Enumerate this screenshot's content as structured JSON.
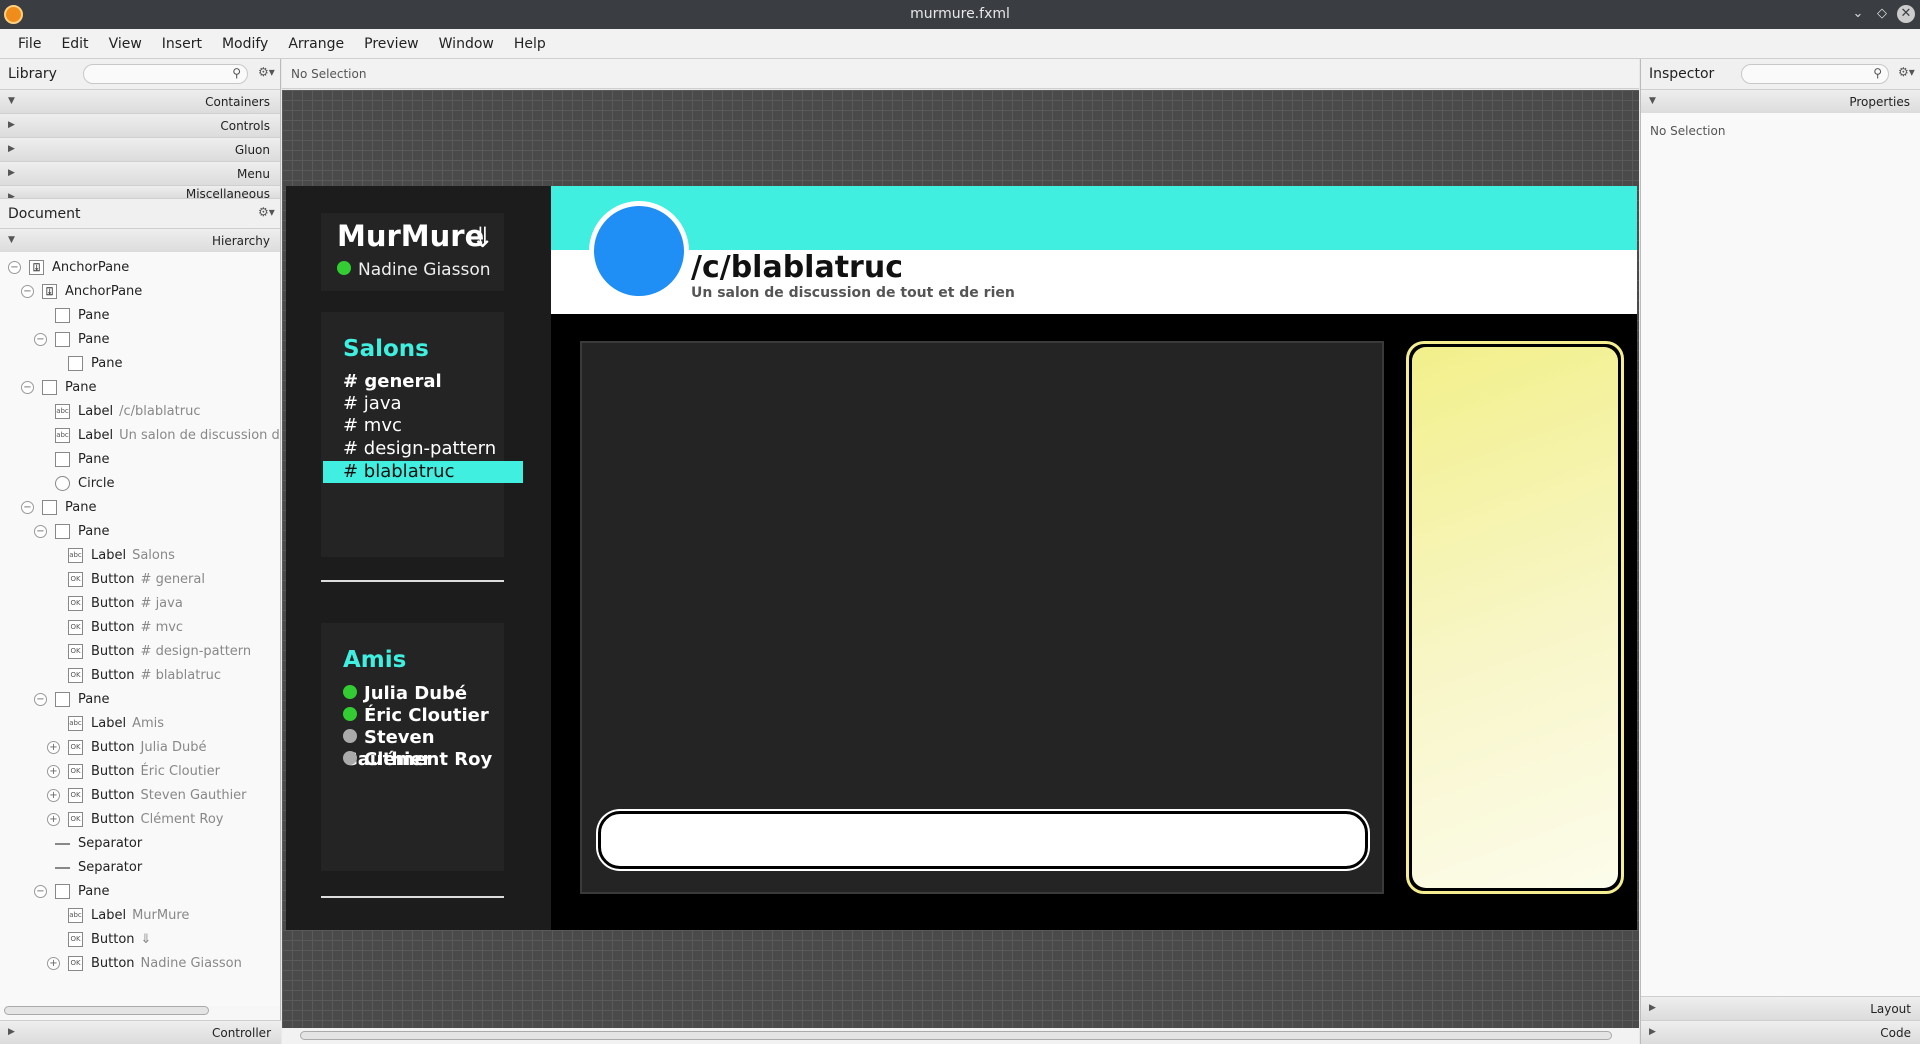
{
  "window": {
    "title": "murmure.fxml"
  },
  "menu": [
    "File",
    "Edit",
    "View",
    "Insert",
    "Modify",
    "Arrange",
    "Preview",
    "Window",
    "Help"
  ],
  "library": {
    "title": "Library",
    "sections": [
      "Containers",
      "Controls",
      "Gluon",
      "Menu",
      "Miscellaneous"
    ]
  },
  "document": {
    "title": "Document",
    "hierarchy_label": "Hierarchy",
    "nodes": [
      {
        "type": "AnchorPane",
        "value": "",
        "depth": 0,
        "toggle": "minus",
        "icon": "anchor"
      },
      {
        "type": "AnchorPane",
        "value": "",
        "depth": 1,
        "toggle": "minus",
        "icon": "anchor"
      },
      {
        "type": "Pane",
        "value": "",
        "depth": 2,
        "toggle": "",
        "icon": "box"
      },
      {
        "type": "Pane",
        "value": "",
        "depth": 2,
        "toggle": "minus",
        "icon": "box"
      },
      {
        "type": "Pane",
        "value": "",
        "depth": 3,
        "toggle": "",
        "icon": "box"
      },
      {
        "type": "Pane",
        "value": "",
        "depth": 1,
        "toggle": "minus",
        "icon": "box"
      },
      {
        "type": "Label",
        "value": "/c/blablatruc",
        "depth": 2,
        "toggle": "",
        "icon": "label"
      },
      {
        "type": "Label",
        "value": "Un salon de discussion de",
        "depth": 2,
        "toggle": "",
        "icon": "label"
      },
      {
        "type": "Pane",
        "value": "",
        "depth": 2,
        "toggle": "",
        "icon": "box"
      },
      {
        "type": "Circle",
        "value": "",
        "depth": 2,
        "toggle": "",
        "icon": "circle"
      },
      {
        "type": "Pane",
        "value": "",
        "depth": 1,
        "toggle": "minus",
        "icon": "box"
      },
      {
        "type": "Pane",
        "value": "",
        "depth": 2,
        "toggle": "minus",
        "icon": "box"
      },
      {
        "type": "Label",
        "value": "Salons",
        "depth": 3,
        "toggle": "",
        "icon": "label"
      },
      {
        "type": "Button",
        "value": "# general",
        "depth": 3,
        "toggle": "",
        "icon": "button"
      },
      {
        "type": "Button",
        "value": "# java",
        "depth": 3,
        "toggle": "",
        "icon": "button"
      },
      {
        "type": "Button",
        "value": "# mvc",
        "depth": 3,
        "toggle": "",
        "icon": "button"
      },
      {
        "type": "Button",
        "value": "# design-pattern",
        "depth": 3,
        "toggle": "",
        "icon": "button"
      },
      {
        "type": "Button",
        "value": "# blablatruc",
        "depth": 3,
        "toggle": "",
        "icon": "button"
      },
      {
        "type": "Pane",
        "value": "",
        "depth": 2,
        "toggle": "minus",
        "icon": "box"
      },
      {
        "type": "Label",
        "value": "Amis",
        "depth": 3,
        "toggle": "",
        "icon": "label"
      },
      {
        "type": "Button",
        "value": "Julia Dubé",
        "depth": 3,
        "toggle": "plus",
        "icon": "button"
      },
      {
        "type": "Button",
        "value": "Éric Cloutier",
        "depth": 3,
        "toggle": "plus",
        "icon": "button"
      },
      {
        "type": "Button",
        "value": "Steven Gauthier",
        "depth": 3,
        "toggle": "plus",
        "icon": "button"
      },
      {
        "type": "Button",
        "value": "Clément Roy",
        "depth": 3,
        "toggle": "plus",
        "icon": "button"
      },
      {
        "type": "Separator",
        "value": "",
        "depth": 2,
        "toggle": "",
        "icon": "separator"
      },
      {
        "type": "Separator",
        "value": "",
        "depth": 2,
        "toggle": "",
        "icon": "separator"
      },
      {
        "type": "Pane",
        "value": "",
        "depth": 2,
        "toggle": "minus",
        "icon": "box"
      },
      {
        "type": "Label",
        "value": "MurMure",
        "depth": 3,
        "toggle": "",
        "icon": "label"
      },
      {
        "type": "Button",
        "value": "⇓",
        "depth": 3,
        "toggle": "",
        "icon": "button"
      },
      {
        "type": "Button",
        "value": "Nadine Giasson",
        "depth": 3,
        "toggle": "plus",
        "icon": "button"
      }
    ]
  },
  "controller_label": "Controller",
  "canvas": {
    "selection_label": "No Selection"
  },
  "preview": {
    "app_name": "MurMure",
    "download_icon": "⇓",
    "current_user": "Nadine Giasson",
    "salons_title": "Salons",
    "channels": [
      "# general",
      "# java",
      "# mvc",
      "# design-pattern",
      "# blablatruc"
    ],
    "amis_title": "Amis",
    "friends": [
      {
        "name": "Julia Dubé",
        "online": true
      },
      {
        "name": "Éric Cloutier",
        "online": true
      },
      {
        "name": "Steven Gauthier",
        "online": false
      },
      {
        "name": "Clément Roy",
        "online": false
      }
    ],
    "channel_title": "/c/blablatruc",
    "channel_desc": "Un salon de discussion de tout et de rien",
    "accent": "#40efdf",
    "avatar_color": "#1f8ef5"
  },
  "inspector": {
    "title": "Inspector",
    "properties_label": "Properties",
    "no_selection": "No Selection",
    "layout_label": "Layout",
    "code_label": "Code"
  }
}
